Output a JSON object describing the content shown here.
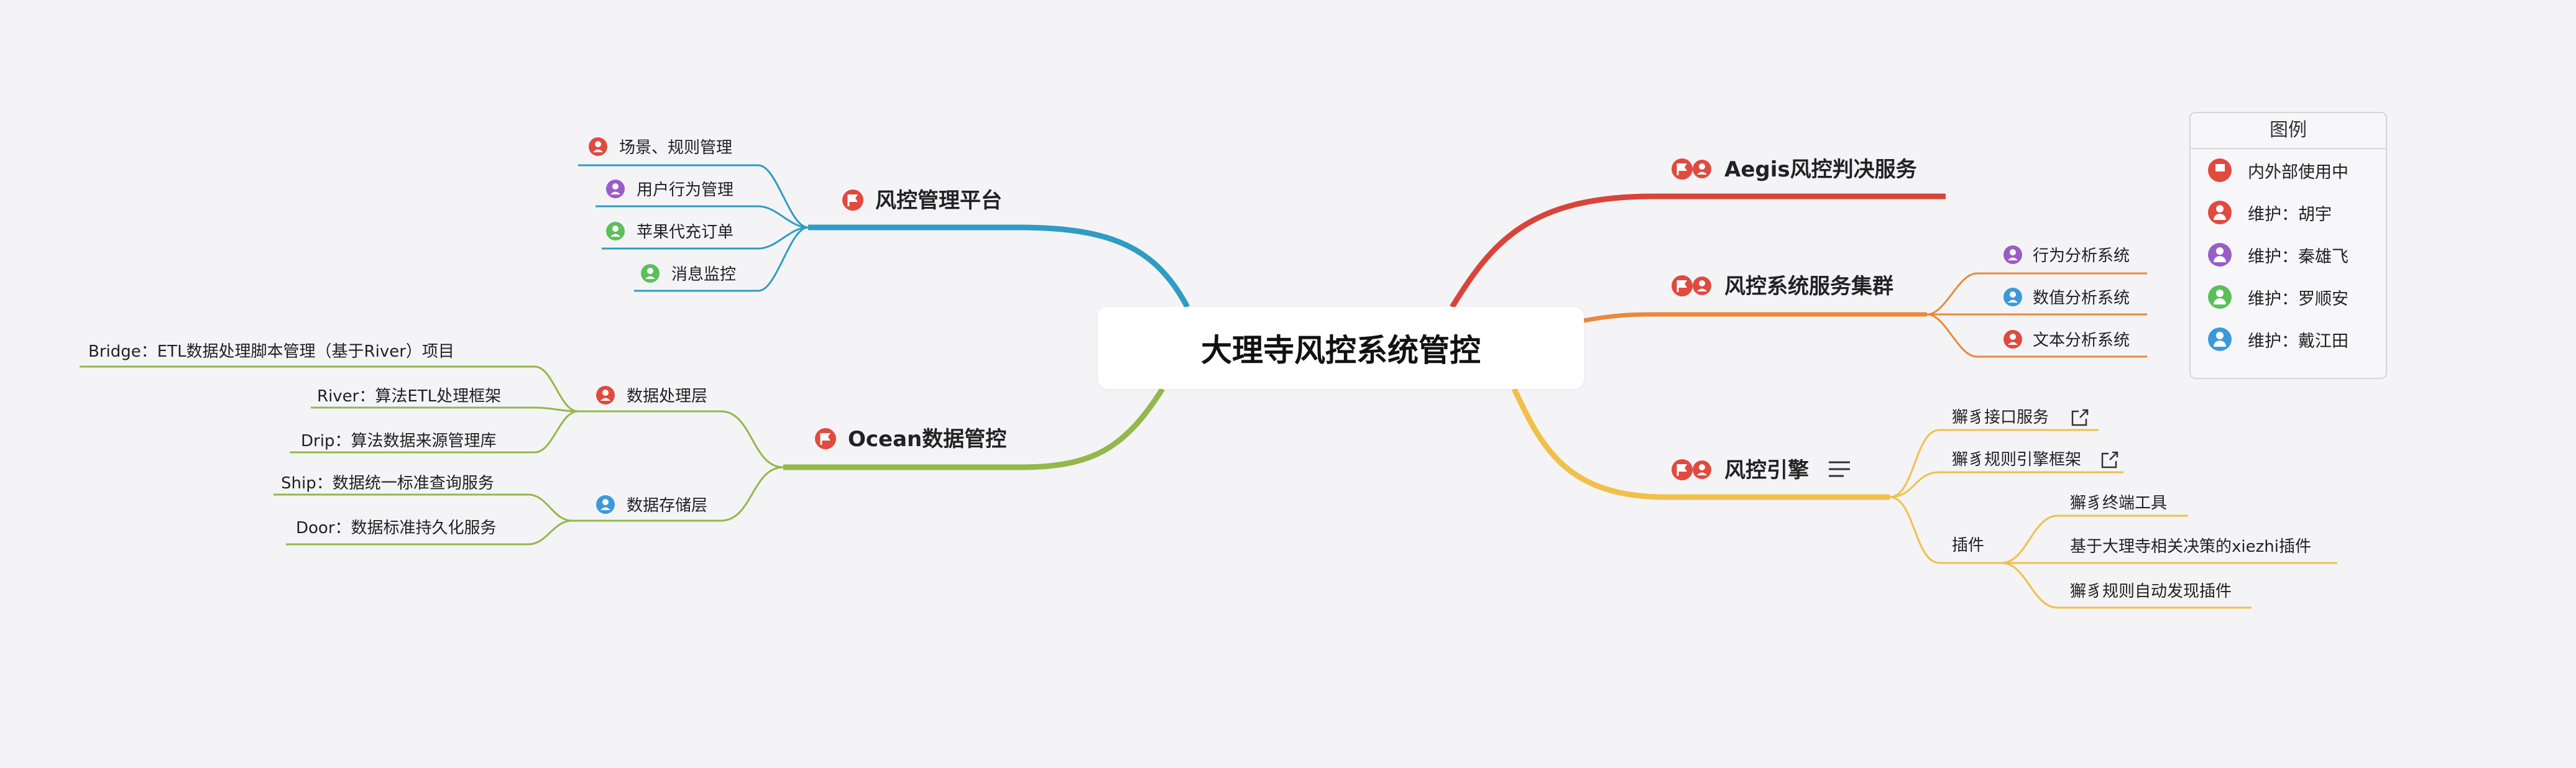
{
  "colors": {
    "red": "#e04a3f",
    "purple": "#9a5cc6",
    "green": "#5cbf5a",
    "blue": "#3a9ad9",
    "branch_mgmt": "#2f9cc4",
    "branch_ocean": "#94b84a",
    "branch_aegis": "#d9443a",
    "branch_cluster": "#e8893c",
    "branch_engine": "#f0c04a"
  },
  "central": {
    "title": "大理寺风控系统管控"
  },
  "branches": {
    "mgmt": {
      "label": "风控管理平台",
      "icon": "flag-icon",
      "children": [
        "场景、规则管理",
        "用户行为管理",
        "苹果代充订单",
        "消息监控"
      ],
      "child_icons": [
        "person-red-icon",
        "person-purple-icon",
        "person-green-icon",
        "person-green-icon"
      ]
    },
    "ocean": {
      "label": "Ocean数据管控",
      "icon": "flag-icon",
      "groups": [
        {
          "label": "数据处理层",
          "icon": "person-red-icon",
          "children": [
            "Bridge：ETL数据处理脚本管理（基于River）项目",
            "River：算法ETL处理框架",
            "Drip：算法数据来源管理库"
          ]
        },
        {
          "label": "数据存储层",
          "icon": "person-blue-icon",
          "children": [
            "Ship：数据统一标准查询服务",
            "Door：数据标准持久化服务"
          ]
        }
      ]
    },
    "aegis": {
      "label": "Aegis风控判决服务",
      "icon": "flag-person-icon"
    },
    "cluster": {
      "label": "风控系统服务集群",
      "icon": "flag-person-icon",
      "children": [
        "行为分析系统",
        "数值分析系统",
        "文本分析系统"
      ],
      "child_icons": [
        "person-purple-icon",
        "person-blue-icon",
        "person-red-icon"
      ]
    },
    "engine": {
      "label": "风控引擎",
      "icon": "flag-person-icon",
      "children": [
        "獬豸接口服务",
        "獬豸规则引擎框架"
      ],
      "plugin": {
        "label": "插件",
        "children": [
          "獬豸终端工具",
          "基于大理寺相关决策的xiezhi插件",
          "獬豸规则自动发现插件"
        ]
      }
    }
  },
  "legend": {
    "title": "图例",
    "items": [
      {
        "label": "内外部使用中",
        "icon": "flag-icon",
        "color": "#e04a3f"
      },
      {
        "label": "维护：胡宇",
        "icon": "person-icon",
        "color": "#e04a3f"
      },
      {
        "label": "维护：秦雄飞",
        "icon": "person-icon",
        "color": "#9a5cc6"
      },
      {
        "label": "维护：罗顺安",
        "icon": "person-icon",
        "color": "#5cbf5a"
      },
      {
        "label": "维护：戴江田",
        "icon": "person-icon",
        "color": "#3a9ad9"
      }
    ]
  }
}
